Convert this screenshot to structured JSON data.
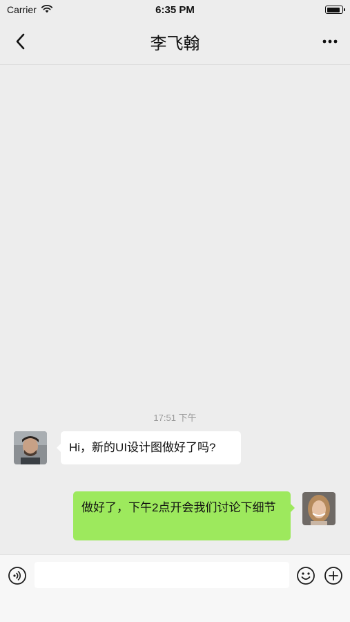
{
  "status_bar": {
    "carrier": "Carrier",
    "time": "6:35 PM",
    "battery_level": 0.9
  },
  "nav": {
    "title": "李飞翰",
    "back_icon": "chevron-left-icon",
    "more_icon": "ellipsis-icon"
  },
  "chat": {
    "timestamp": "17:51 下午",
    "messages": [
      {
        "direction": "incoming",
        "text": "Hi，新的UI设计图做好了吗?"
      },
      {
        "direction": "outgoing",
        "text": "做好了，下午2点开会我们讨论下细节"
      }
    ]
  },
  "input_bar": {
    "value": "",
    "placeholder": "",
    "icons": [
      "voice-icon",
      "emoji-icon",
      "plus-icon"
    ]
  },
  "colors": {
    "background": "#ededed",
    "outgoing_bubble": "#9de95d",
    "incoming_bubble": "#ffffff",
    "timestamp": "#9a9a9a"
  }
}
